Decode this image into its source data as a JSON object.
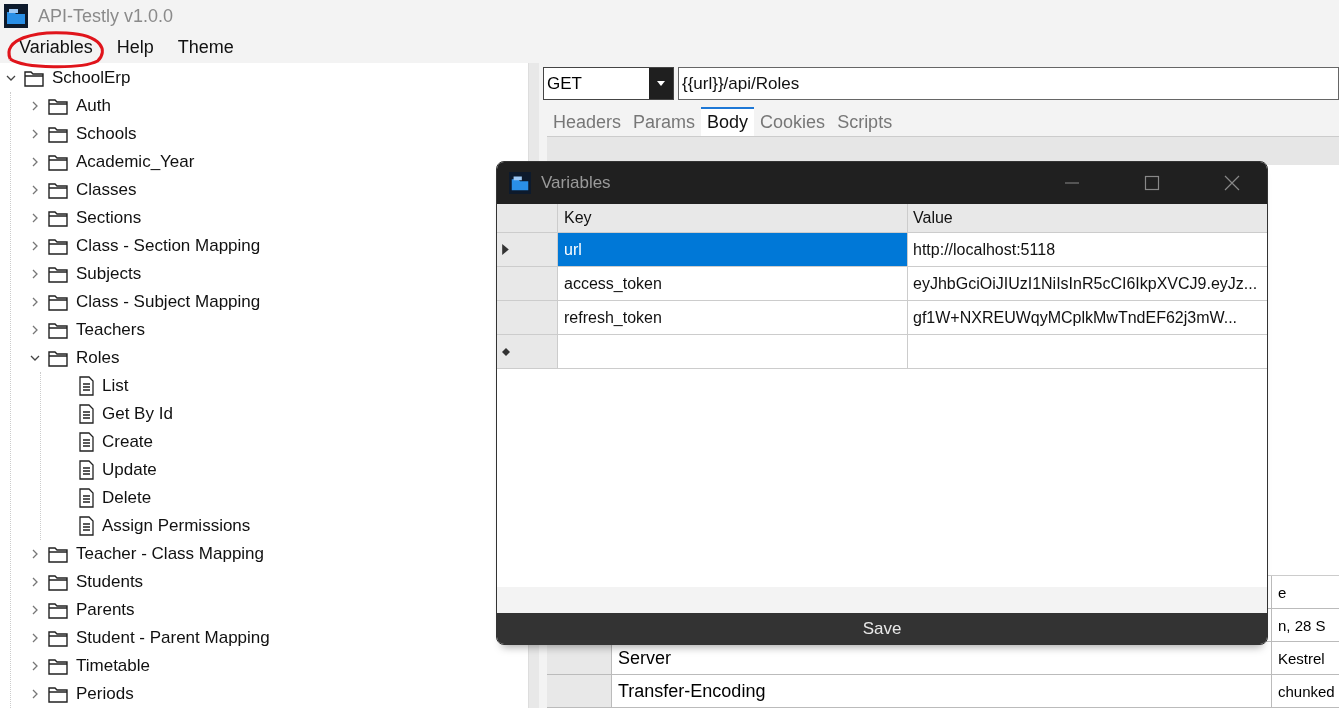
{
  "window": {
    "title": "API-Testly v1.0.0"
  },
  "menu": [
    {
      "label": "Variables",
      "circled": true
    },
    {
      "label": "Help",
      "circled": false
    },
    {
      "label": "Theme",
      "circled": false
    }
  ],
  "tree": [
    {
      "label": "SchoolErp",
      "kind": "folder",
      "expanded": true,
      "children": [
        {
          "label": "Auth",
          "kind": "folder",
          "expanded": false
        },
        {
          "label": "Schools",
          "kind": "folder",
          "expanded": false
        },
        {
          "label": "Academic_Year",
          "kind": "folder",
          "expanded": false
        },
        {
          "label": "Classes",
          "kind": "folder",
          "expanded": false
        },
        {
          "label": "Sections",
          "kind": "folder",
          "expanded": false
        },
        {
          "label": "Class - Section Mapping",
          "kind": "folder",
          "expanded": false
        },
        {
          "label": "Subjects",
          "kind": "folder",
          "expanded": false
        },
        {
          "label": "Class - Subject Mapping",
          "kind": "folder",
          "expanded": false
        },
        {
          "label": "Teachers",
          "kind": "folder",
          "expanded": false
        },
        {
          "label": "Roles",
          "kind": "folder",
          "expanded": true,
          "children": [
            {
              "label": "List",
              "kind": "file"
            },
            {
              "label": "Get By Id",
              "kind": "file"
            },
            {
              "label": "Create",
              "kind": "file"
            },
            {
              "label": "Update",
              "kind": "file"
            },
            {
              "label": "Delete",
              "kind": "file"
            },
            {
              "label": "Assign Permissions",
              "kind": "file"
            }
          ]
        },
        {
          "label": "Teacher - Class Mapping",
          "kind": "folder",
          "expanded": false
        },
        {
          "label": "Students",
          "kind": "folder",
          "expanded": false
        },
        {
          "label": "Parents",
          "kind": "folder",
          "expanded": false
        },
        {
          "label": "Student - Parent Mapping",
          "kind": "folder",
          "expanded": false
        },
        {
          "label": "Timetable",
          "kind": "folder",
          "expanded": false
        },
        {
          "label": "Periods",
          "kind": "folder",
          "expanded": false
        }
      ]
    }
  ],
  "request": {
    "method": "GET",
    "url": "{{url}}/api/Roles"
  },
  "tabs": [
    {
      "label": "Headers",
      "selected": false
    },
    {
      "label": "Params",
      "selected": false
    },
    {
      "label": "Body",
      "selected": true
    },
    {
      "label": "Cookies",
      "selected": false
    },
    {
      "label": "Scripts",
      "selected": false
    }
  ],
  "response_headers": {
    "column_2": "e",
    "rows": [
      {
        "name": "",
        "value": "n, 28 S"
      },
      {
        "name": "Server",
        "value": "Kestrel"
      },
      {
        "name": "Transfer-Encoding",
        "value": "chunked"
      }
    ]
  },
  "dialog": {
    "title": "Variables",
    "columns": [
      "Key",
      "Value"
    ],
    "rows": [
      {
        "key": "url",
        "value": "http://localhost:5118",
        "selected": true
      },
      {
        "key": "access_token",
        "value": "eyJhbGciOiJIUzI1NiIsInR5cCI6IkpXVCJ9.eyJz...",
        "selected": false
      },
      {
        "key": "refresh_token",
        "value": "gf1W+NXREUWqyMCplkMwTndEF62j3mW...",
        "selected": false
      }
    ],
    "save": "Save"
  }
}
